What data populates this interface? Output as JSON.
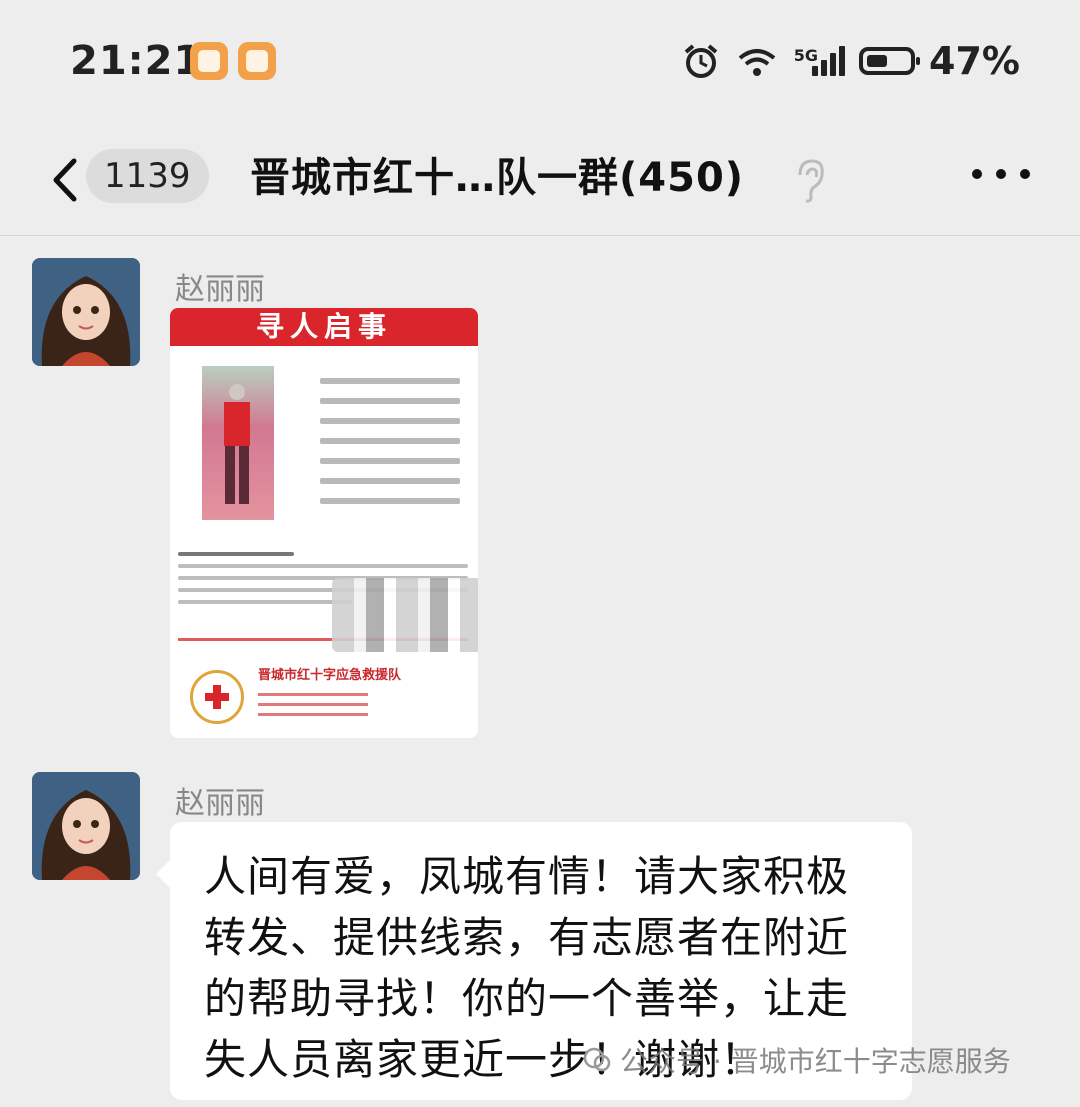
{
  "status": {
    "time": "21:21",
    "network_tag": "5G",
    "battery": "47%",
    "battery_level": 0.47,
    "wifi_tag": "6"
  },
  "nav": {
    "unread_count": "1139",
    "title": "晋城市红十…队一群(450)"
  },
  "messages": [
    {
      "sender": "赵丽丽",
      "type": "image",
      "poster": {
        "header": "寻人启事",
        "org": "晋城市红十字应急救援队"
      }
    },
    {
      "sender": "赵丽丽",
      "type": "text",
      "lines": [
        "人间有爱，凤城有情！请大家积极",
        "转发、提供线索，有志愿者在附近",
        "的帮助寻找！你的一个善举，让走",
        "失人员离家更近一步！谢谢！"
      ]
    }
  ],
  "watermark": "公众号 · 晋城市红十字志愿服务",
  "colors": {
    "background": "#ededed",
    "poster_red": "#d9252b",
    "bubble": "#ffffff"
  }
}
